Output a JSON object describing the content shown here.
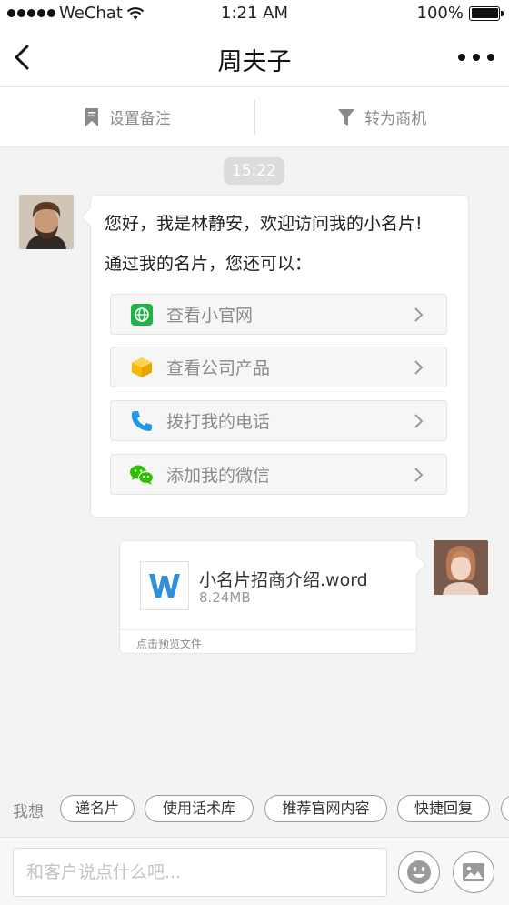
{
  "status_bar": {
    "carrier": "WeChat",
    "time": "1:21 AM",
    "battery": "100%"
  },
  "nav": {
    "title": "周夫子",
    "back_icon": "chevron-left-icon",
    "more_icon": "more-dots-icon"
  },
  "actions": {
    "remark_label": "设置备注",
    "convert_label": "转为商机"
  },
  "chat": {
    "timestamp": "15:22",
    "greeting": "您好，我是林静安，欢迎访问我的小名片!",
    "subtext": "通过我的名片，您还可以：",
    "options": [
      {
        "label": "查看小官网",
        "icon": "globe-icon",
        "color": "#22b14c"
      },
      {
        "label": "查看公司产品",
        "icon": "box-icon",
        "color": "#f5b700"
      },
      {
        "label": "拨打我的电话",
        "icon": "phone-icon",
        "color": "#1e9be8"
      },
      {
        "label": "添加我的微信",
        "icon": "wechat-icon",
        "color": "#2dc100"
      }
    ],
    "file": {
      "name": "小名片招商介绍.word",
      "size": "8.24MB",
      "preview_label": "点击预览文件",
      "icon": "word-doc-icon",
      "icon_color": "#2f8fd8"
    }
  },
  "quick_replies": {
    "prompt": "我想",
    "chips": [
      "递名片",
      "使用话术库",
      "推荐官网内容",
      "快捷回复"
    ]
  },
  "input": {
    "placeholder": "和客户说点什么吧...",
    "emoji_icon": "emoji-icon",
    "image_icon": "image-icon"
  }
}
